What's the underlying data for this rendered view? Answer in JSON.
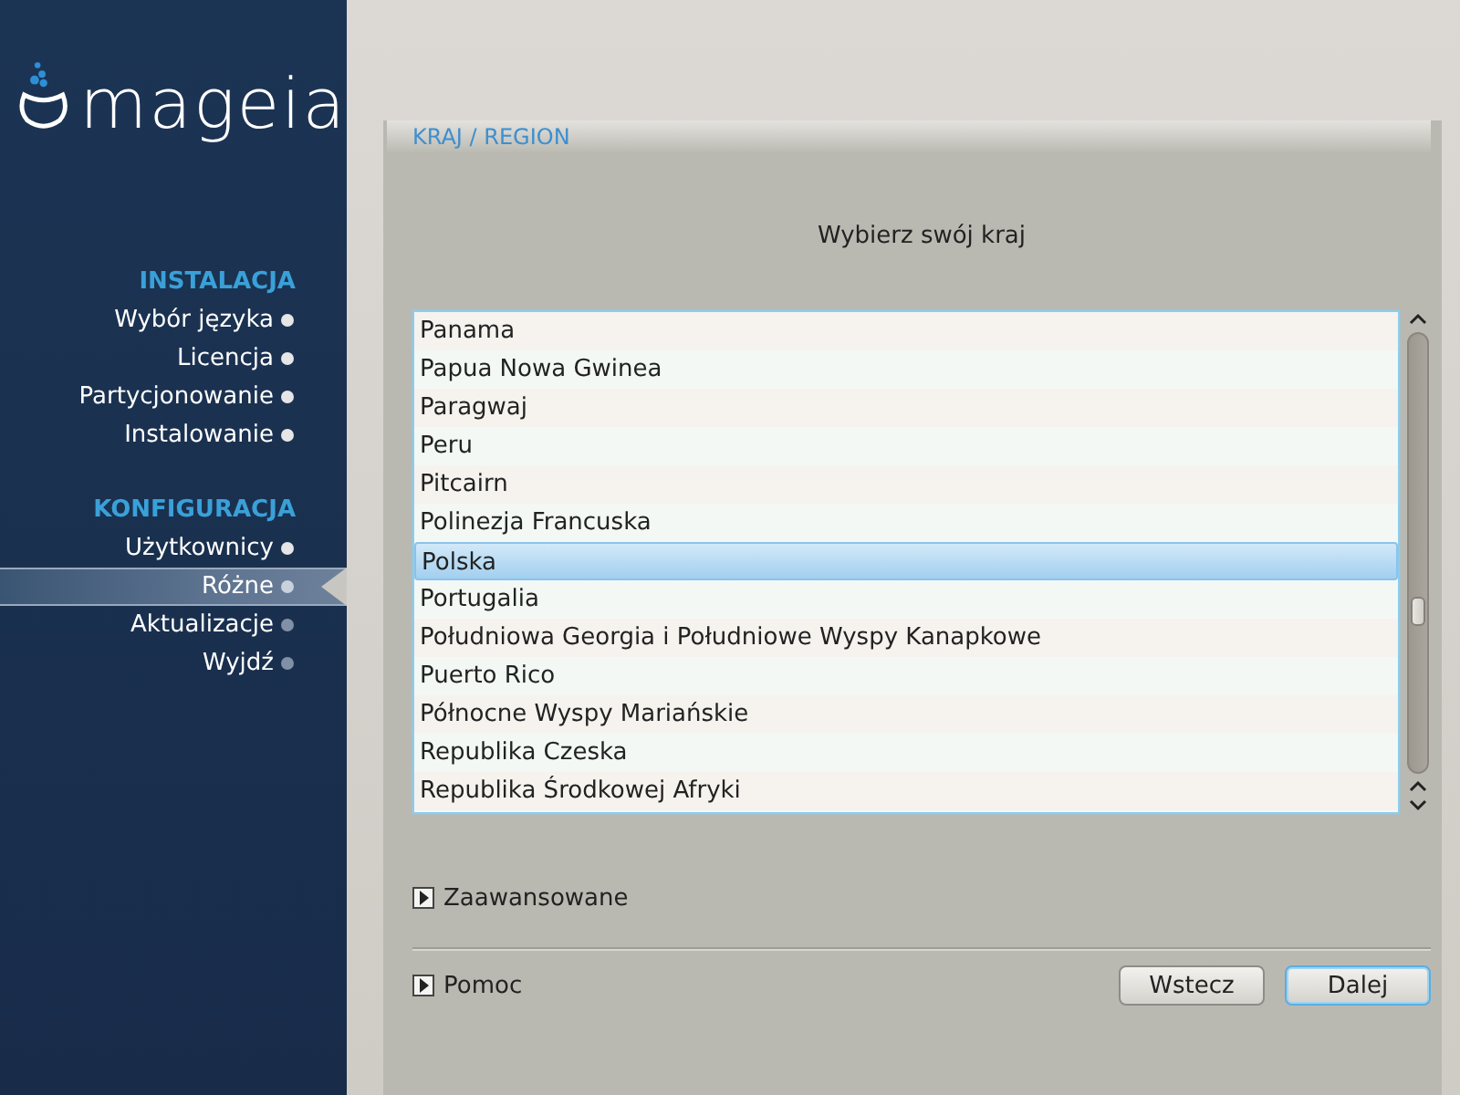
{
  "sidebar": {
    "logo": "mageia",
    "sections": [
      {
        "title": "INSTALACJA",
        "items": [
          {
            "label": "Wybór języka",
            "done": true,
            "selected": false
          },
          {
            "label": "Licencja",
            "done": true,
            "selected": false
          },
          {
            "label": "Partycjonowanie",
            "done": true,
            "selected": false
          },
          {
            "label": "Instalowanie",
            "done": true,
            "selected": false
          }
        ]
      },
      {
        "title": "KONFIGURACJA",
        "items": [
          {
            "label": "Użytkownicy",
            "done": true,
            "selected": false
          },
          {
            "label": "Różne",
            "done": false,
            "selected": true
          },
          {
            "label": "Aktualizacje",
            "done": false,
            "selected": false
          },
          {
            "label": "Wyjdź",
            "done": false,
            "selected": false
          }
        ]
      }
    ]
  },
  "page": {
    "header": "KRAJ / REGION",
    "title": "Wybierz swój kraj",
    "countries": [
      {
        "label": "Panama",
        "selected": false
      },
      {
        "label": "Papua Nowa Gwinea",
        "selected": false
      },
      {
        "label": "Paragwaj",
        "selected": false
      },
      {
        "label": "Peru",
        "selected": false
      },
      {
        "label": "Pitcairn",
        "selected": false
      },
      {
        "label": "Polinezja Francuska",
        "selected": false
      },
      {
        "label": "Polska",
        "selected": true
      },
      {
        "label": "Portugalia",
        "selected": false
      },
      {
        "label": "Południowa Georgia i Południowe Wyspy Kanapkowe",
        "selected": false
      },
      {
        "label": "Puerto Rico",
        "selected": false
      },
      {
        "label": "Północne Wyspy Mariańskie",
        "selected": false
      },
      {
        "label": "Republika Czeska",
        "selected": false
      },
      {
        "label": "Republika Środkowej Afryki",
        "selected": false
      }
    ],
    "advanced": {
      "label": "Zaawansowane",
      "expanded": false
    },
    "help": {
      "label": "Pomoc",
      "expanded": false
    },
    "buttons": [
      {
        "label": "Wstecz",
        "default": false
      },
      {
        "label": "Dalej",
        "default": true
      }
    ]
  }
}
